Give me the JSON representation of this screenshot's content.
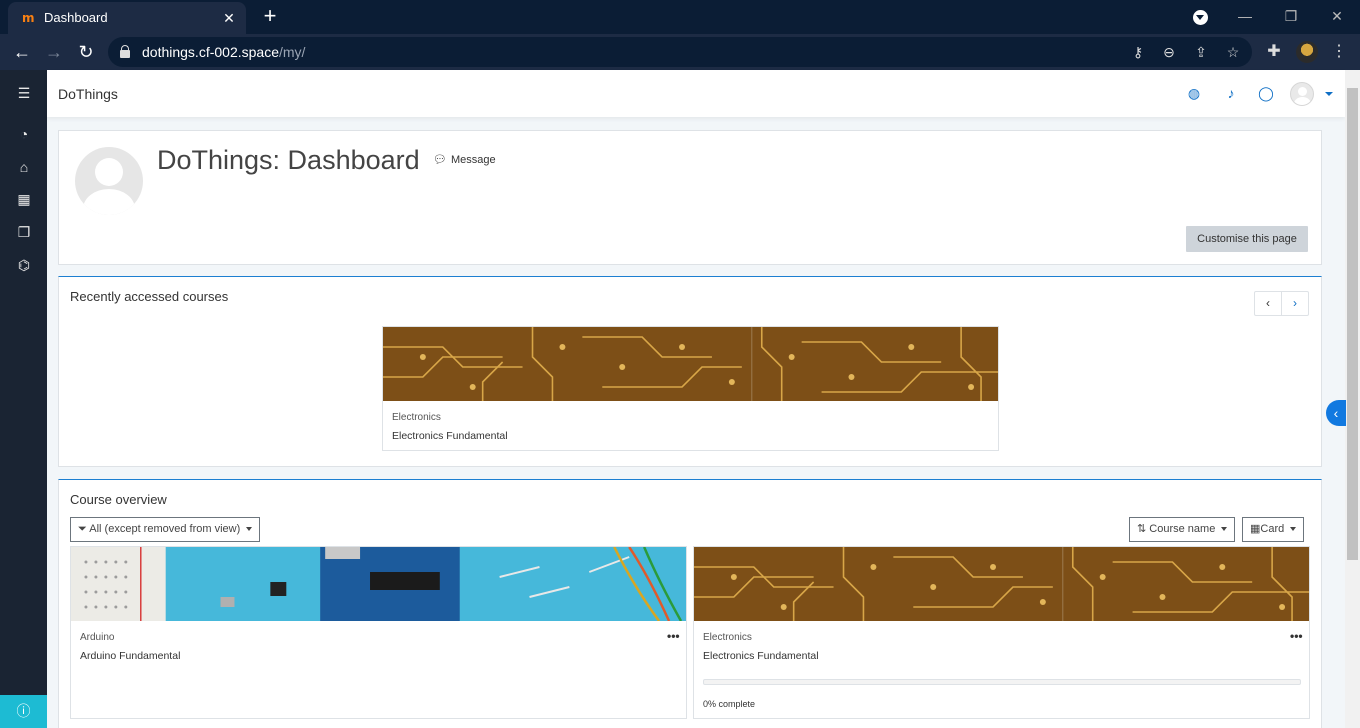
{
  "browser": {
    "tab_title": "Dashboard",
    "favicon": "m",
    "tab_close": "✕",
    "new_tab": "+",
    "url_host": "dothings.cf-002.space",
    "url_path": "/my/",
    "icons": [
      "back-icon",
      "forward-icon",
      "reload-icon",
      "lock-icon",
      "key-icon",
      "zoom-out-icon",
      "share-icon",
      "star-icon",
      "extensions-icon",
      "menu-icon"
    ]
  },
  "leftnav": {
    "icons": [
      "menu-icon",
      "dashboard-icon",
      "home-icon",
      "calendar-icon",
      "files-icon",
      "courses-icon"
    ]
  },
  "navbar": {
    "site_name": "DoThings",
    "icons": [
      "globe-icon",
      "bell-icon",
      "chat-icon"
    ]
  },
  "header": {
    "title": "DoThings: Dashboard",
    "message_label": "Message",
    "customise_label": "Customise this page"
  },
  "recent": {
    "title": "Recently accessed courses",
    "courses": [
      {
        "category": "Electronics",
        "name": "Electronics Fundamental"
      }
    ]
  },
  "overview": {
    "title": "Course overview",
    "filter_label": "All (except removed from view)",
    "sort_label": "Course name",
    "view_label": "Card",
    "courses": [
      {
        "category": "Arduino",
        "name": "Arduino Fundamental"
      },
      {
        "category": "Electronics",
        "name": "Electronics Fundamental",
        "progress_text": "0% complete",
        "progress_percent": 0
      }
    ]
  },
  "colors": {
    "accent": "#0f6fc5",
    "leftnav_bg": "#1a2433",
    "info_btn": "#1dbbd3"
  }
}
